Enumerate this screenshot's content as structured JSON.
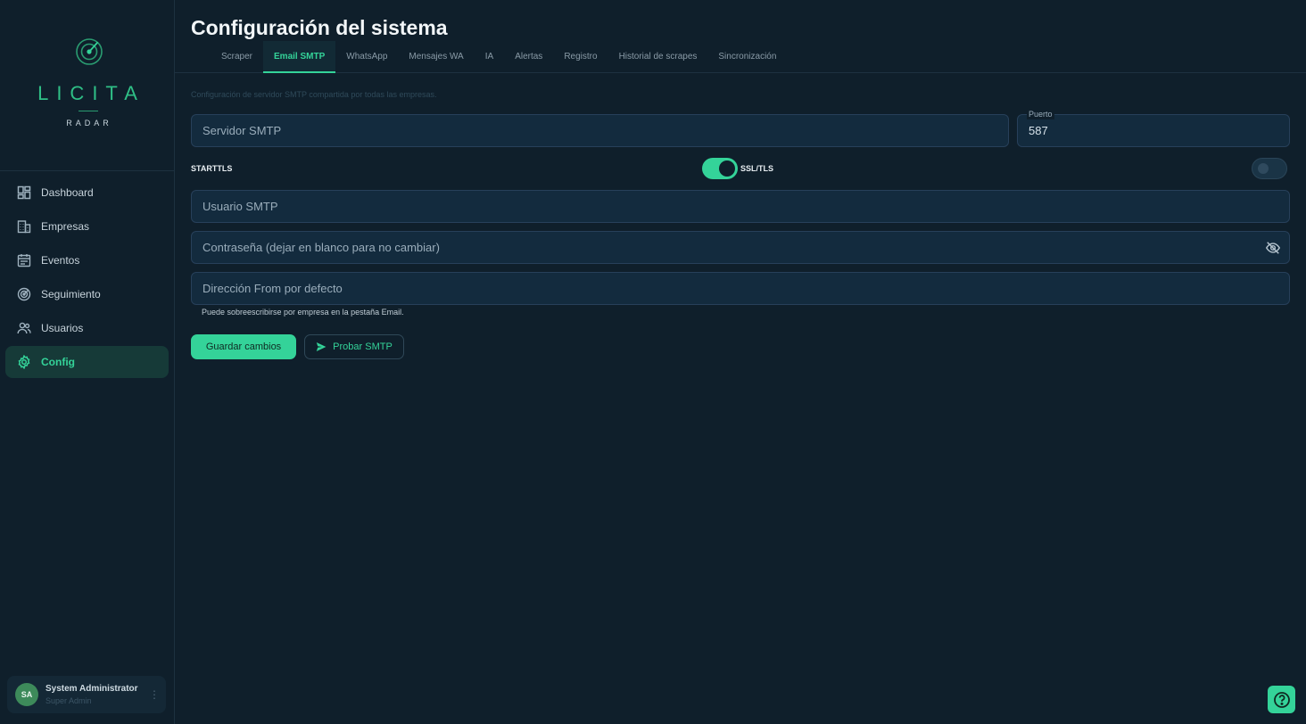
{
  "brand": {
    "name": "LICITA",
    "sub": "RADAR",
    "accent": "#34d399"
  },
  "sidebar": {
    "items": [
      {
        "label": "Dashboard",
        "icon": "dashboard-icon",
        "active": false
      },
      {
        "label": "Empresas",
        "icon": "building-icon",
        "active": false
      },
      {
        "label": "Eventos",
        "icon": "calendar-icon",
        "active": false
      },
      {
        "label": "Seguimiento",
        "icon": "radar-icon",
        "active": false
      },
      {
        "label": "Usuarios",
        "icon": "users-icon",
        "active": false
      },
      {
        "label": "Config",
        "icon": "gear-icon",
        "active": true
      }
    ]
  },
  "user": {
    "initials": "SA",
    "name": "System Administrator",
    "role": "Super Admin"
  },
  "page": {
    "title": "Configuración del sistema"
  },
  "tabs": [
    {
      "label": "Scraper",
      "active": false
    },
    {
      "label": "Email SMTP",
      "active": true
    },
    {
      "label": "WhatsApp",
      "active": false
    },
    {
      "label": "Mensajes WA",
      "active": false
    },
    {
      "label": "IA",
      "active": false
    },
    {
      "label": "Alertas",
      "active": false
    },
    {
      "label": "Registro",
      "active": false
    },
    {
      "label": "Historial de scrapes",
      "active": false
    },
    {
      "label": "Sincronización",
      "active": false
    }
  ],
  "smtp": {
    "description": "Configuración de servidor SMTP compartida por todas las empresas.",
    "server_placeholder": "Servidor SMTP",
    "port_label": "Puerto",
    "port_value": "587",
    "starttls_label": "STARTTLS",
    "starttls_on": true,
    "ssl_label": "SSL/TLS",
    "ssl_on": false,
    "user_placeholder": "Usuario SMTP",
    "password_placeholder": "Contraseña (dejar en blanco para no cambiar)",
    "from_placeholder": "Dirección From por defecto",
    "from_hint": "Puede sobreescribirse por empresa en la pestaña Email.",
    "save_label": "Guardar cambios",
    "test_label": "Probar SMTP"
  }
}
